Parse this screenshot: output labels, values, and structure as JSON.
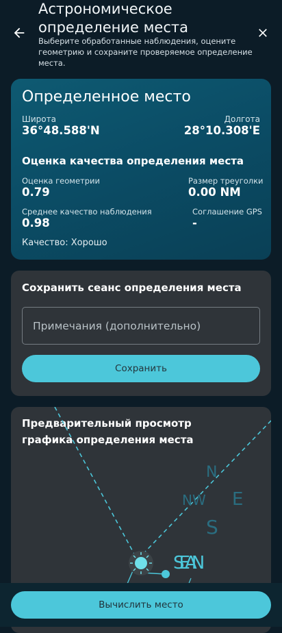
{
  "header": {
    "title": "Астрономическое определение места",
    "subtitle": "Выберите обработанные наблюдения, оцените геометрию и сохраните проверяемое определение места."
  },
  "fix": {
    "title": "Определенное место",
    "latitude_label": "Широта",
    "latitude_value": "36°48.588'N",
    "longitude_label": "Долгота",
    "longitude_value": "28°10.308'E",
    "quality_title": "Оценка качества определения места",
    "geometry_label": "Оценка геометрии",
    "geometry_value": "0.79",
    "triangle_label": "Размер треуголки",
    "triangle_value": "0.00 NM",
    "obs_quality_label": "Среднее качество наблюдения",
    "obs_quality_value": "0.98",
    "gps_label": "Соглашение GPS",
    "gps_value": "-",
    "quality_text": "Качество: Хорошо"
  },
  "save": {
    "title": "Сохранить сеанс определения места",
    "notes_placeholder": "Примечания (дополнительно)",
    "notes_value": "",
    "button_label": "Сохранить"
  },
  "preview": {
    "title": "Предварительный просмотр графика определения места",
    "labels": {
      "n": "N",
      "nw": "NW",
      "e": "E",
      "s": "S",
      "s_e_a_n_stack": "SEAN"
    }
  },
  "actions": {
    "compute_label": "Вычислить место"
  },
  "colors": {
    "background": "#0c1c27",
    "fix_card": "#0b4d66",
    "panel": "#2f3439",
    "accent": "#4cc7da"
  }
}
